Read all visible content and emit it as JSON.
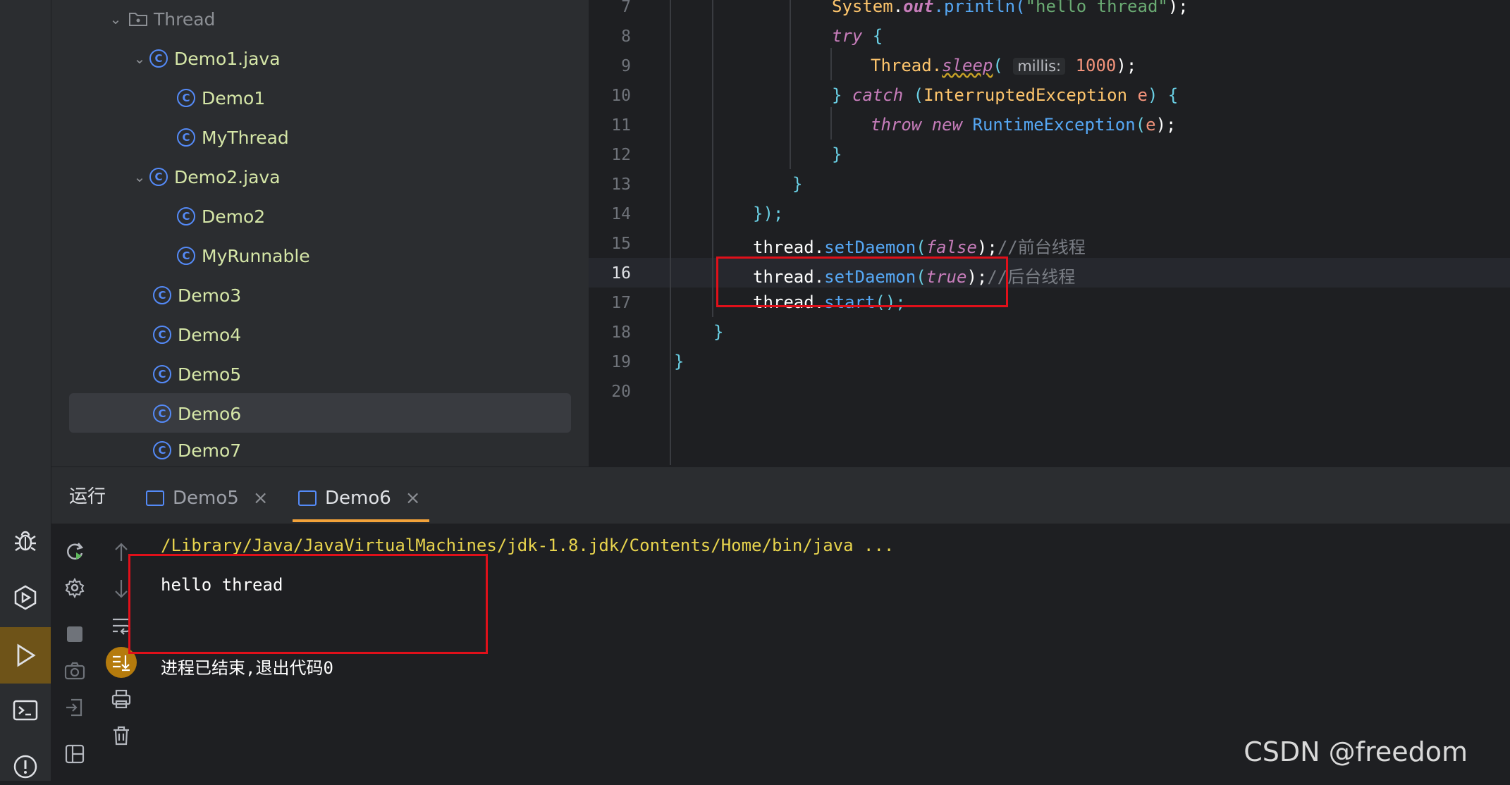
{
  "project_tree": {
    "items": [
      {
        "label": "Thread",
        "kind": "folder",
        "expanded": true
      },
      {
        "label": "Demo1.java",
        "kind": "file",
        "expanded": true
      },
      {
        "label": "Demo1",
        "kind": "class"
      },
      {
        "label": "MyThread",
        "kind": "class"
      },
      {
        "label": "Demo2.java",
        "kind": "file",
        "expanded": true
      },
      {
        "label": "Demo2",
        "kind": "class"
      },
      {
        "label": "MyRunnable",
        "kind": "class"
      },
      {
        "label": "Demo3",
        "kind": "class"
      },
      {
        "label": "Demo4",
        "kind": "class"
      },
      {
        "label": "Demo5",
        "kind": "class"
      },
      {
        "label": "Demo6",
        "kind": "class",
        "selected": true
      },
      {
        "label": "Demo7",
        "kind": "class"
      }
    ],
    "class_icon_letter": "C"
  },
  "editor": {
    "line_numbers": [
      "7",
      "8",
      "9",
      "10",
      "11",
      "12",
      "13",
      "14",
      "15",
      "16",
      "17",
      "18",
      "19",
      "20"
    ],
    "current_line": "16",
    "code": {
      "l7": {
        "a": "System",
        "b": ".",
        "c": "out",
        "d": ".println(",
        "e": "\"hello thread\"",
        "f": ");"
      },
      "l8": {
        "a": "try",
        "b": " {"
      },
      "l9": {
        "a": "Thread.",
        "b": "sleep",
        "c": "(",
        "hint": "millis:",
        "d": "1000",
        "e": ");"
      },
      "l10": {
        "a": "} ",
        "b": "catch",
        "c": " (",
        "d": "InterruptedException",
        "e": " e",
        "f": ") {"
      },
      "l11": {
        "a": "throw",
        "b": " ",
        "c": "new",
        "d": " RuntimeException",
        "e": "(",
        "f": "e",
        "g": ");"
      },
      "l12": {
        "a": "}"
      },
      "l13": {
        "a": "}"
      },
      "l14": {
        "a": "});"
      },
      "l15": {
        "a": "thread",
        "b": ".",
        "c": "setDaemon",
        "d": "(",
        "e": "false",
        "f": ");",
        "g": "//前台线程"
      },
      "l16": {
        "a": "thread",
        "b": ".",
        "c": "setDaemon",
        "d": "(",
        "e": "true",
        "f": ");",
        "g": "//后台线程"
      },
      "l17": {
        "a": "thread",
        "b": ".",
        "c": "start",
        "d": "();"
      },
      "l18": {
        "a": "}"
      },
      "l19": {
        "a": "}"
      }
    }
  },
  "run_panel": {
    "title": "运行",
    "tabs": [
      {
        "label": "Demo5",
        "active": false
      },
      {
        "label": "Demo6",
        "active": true
      }
    ],
    "close_glyph": "×",
    "console": {
      "command": "/Library/Java/JavaVirtualMachines/jdk-1.8.jdk/Contents/Home/bin/java ...",
      "output": "hello thread",
      "exit": "进程已结束,退出代码0"
    }
  },
  "watermark": "CSDN @freedom",
  "colors": {
    "accent_tab": "#f2a23a",
    "highlight_box": "#e0101a",
    "active_tool": "#6e5318"
  }
}
